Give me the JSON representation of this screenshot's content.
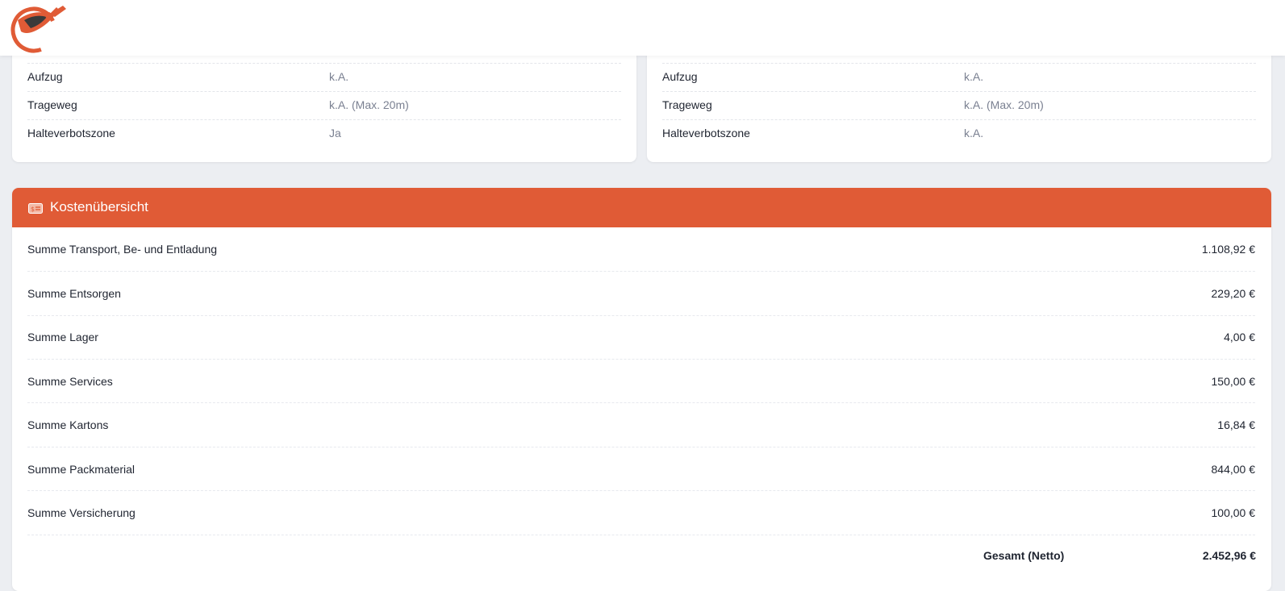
{
  "left_panel": {
    "rows": [
      {
        "label": "Aufzug",
        "value": "k.A."
      },
      {
        "label": "Trageweg",
        "value": "k.A. (Max. 20m)"
      },
      {
        "label": "Halteverbotszone",
        "value": "Ja"
      }
    ]
  },
  "right_panel": {
    "rows": [
      {
        "label": "Aufzug",
        "value": "k.A."
      },
      {
        "label": "Trageweg",
        "value": "k.A. (Max. 20m)"
      },
      {
        "label": "Halteverbotszone",
        "value": "k.A."
      }
    ]
  },
  "cost_overview": {
    "title": "Kostenübersicht",
    "items": [
      {
        "label": "Summe Transport, Be- und Entladung",
        "amount": "1.108,92 €"
      },
      {
        "label": "Summe Entsorgen",
        "amount": "229,20 €"
      },
      {
        "label": "Summe Lager",
        "amount": "4,00 €"
      },
      {
        "label": "Summe Services",
        "amount": "150,00 €"
      },
      {
        "label": "Summe Kartons",
        "amount": "16,84 €"
      },
      {
        "label": "Summe Packmaterial",
        "amount": "844,00 €"
      },
      {
        "label": "Summe Versicherung",
        "amount": "100,00 €"
      }
    ],
    "total_label": "Gesamt (Netto)",
    "total_amount": "2.452,96 €"
  },
  "colors": {
    "accent": "#e05b36",
    "page_background": "#eceef2",
    "muted_text": "#7a8091"
  },
  "icons": {
    "logo": "superhero-mover-logo",
    "cost_header": "cash-icon"
  }
}
